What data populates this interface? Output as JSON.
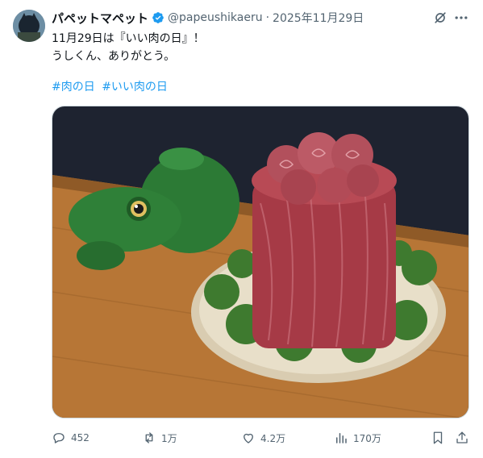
{
  "tweet": {
    "display_name": "パペットマペット",
    "handle": "@papeushikaeru",
    "separator": "·",
    "date": "2025年11月29日",
    "text_lines": [
      "11月29日は『いい肉の日』！",
      "うしくん、ありがとう。"
    ],
    "hashtags": [
      "#肉の日",
      "#いい肉の日"
    ],
    "verified": true
  },
  "actions": {
    "replies": "452",
    "retweets": "1万",
    "likes": "4.2万",
    "views": "170万"
  },
  "icons": {
    "verified": "verified-badge-icon",
    "grok": "grok-icon",
    "more": "more-icon",
    "reply": "reply-icon",
    "retweet": "retweet-icon",
    "like": "like-icon",
    "views": "views-icon",
    "bookmark": "bookmark-icon",
    "share": "share-icon"
  },
  "colors": {
    "accent": "#1d9bf0",
    "secondary_text": "#536471",
    "primary_text": "#0f1419"
  }
}
